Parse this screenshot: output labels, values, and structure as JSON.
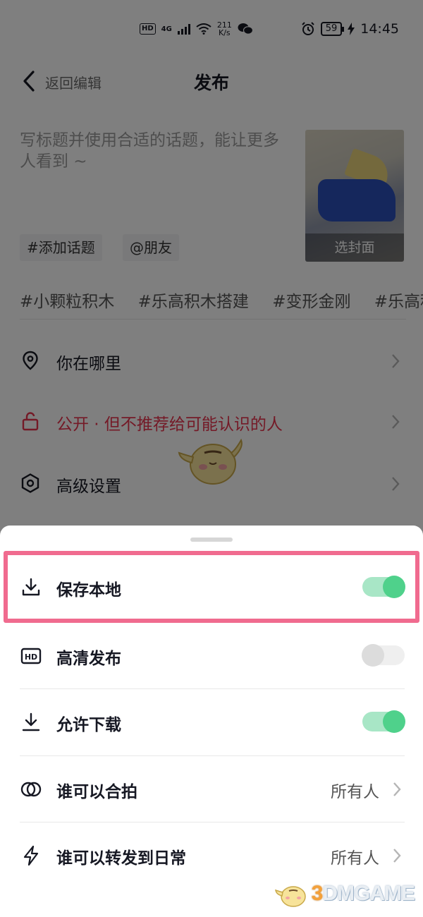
{
  "status_bar": {
    "hd": "HD",
    "network": "4G",
    "speed_top": "211",
    "speed_bottom": "K/s",
    "battery": "59",
    "time": "14:45"
  },
  "nav": {
    "back_label": "返回编辑",
    "title": "发布"
  },
  "post": {
    "description_placeholder": "写标题并使用合适的话题，能让更多人看到 ~",
    "add_topic_button": "#添加话题",
    "mention_button": "@朋友",
    "cover_label": "选封面",
    "suggested_topics": [
      "#小颗粒积木",
      "#乐高积木搭建",
      "#变形金刚",
      "#乐高积"
    ]
  },
  "settings_rows": [
    {
      "label": "你在哪里",
      "icon": "location-pin-icon"
    },
    {
      "label": "公开 · 但不推荐给可能认识的人",
      "icon": "unlock-icon",
      "color": "#e8354f"
    },
    {
      "label": "高级设置",
      "icon": "hexagon-settings-icon"
    }
  ],
  "sheet": {
    "rows": [
      {
        "label": "保存本地",
        "icon": "download-tray-icon",
        "toggle": true
      },
      {
        "label": "高清发布",
        "icon": "hd-icon",
        "toggle": false
      },
      {
        "label": "允许下载",
        "icon": "download-icon",
        "toggle": true
      },
      {
        "label": "谁可以合拍",
        "icon": "duet-icon",
        "value": "所有人"
      },
      {
        "label": "谁可以转发到日常",
        "icon": "lightning-icon",
        "value": "所有人"
      }
    ]
  },
  "colors": {
    "toggle_on": "#4fd18b",
    "toggle_off": "#dcdcdc",
    "highlight": "#f06b8f",
    "warning_red": "#e8354f"
  },
  "watermark": {
    "prefix": "3",
    "text": "DMGAME"
  }
}
